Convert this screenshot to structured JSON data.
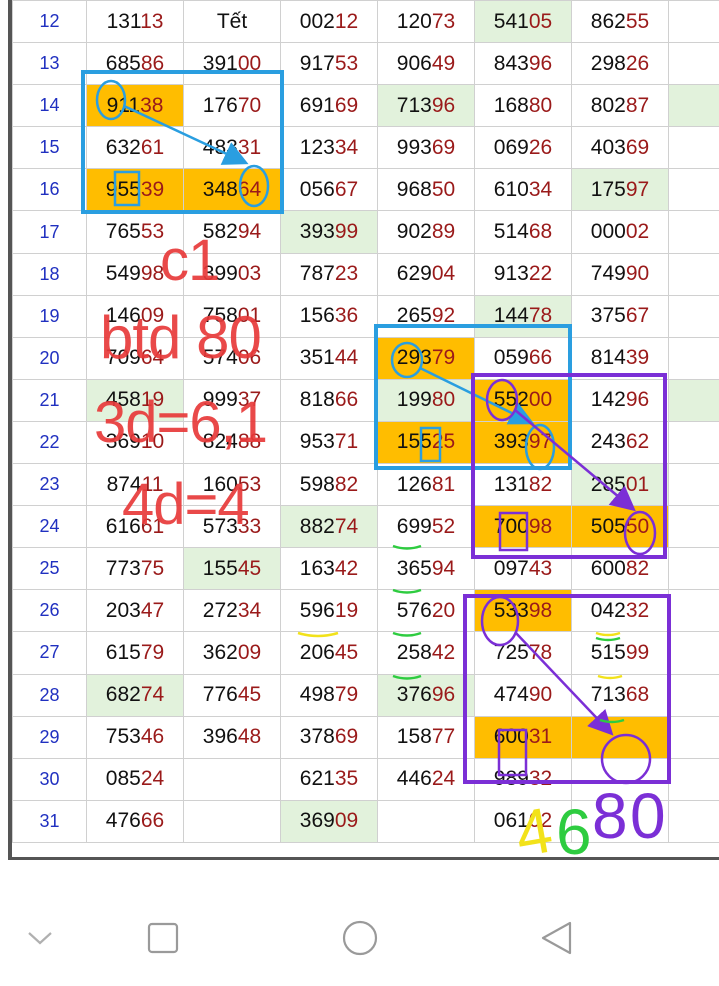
{
  "rows": [
    {
      "day": "12",
      "cells": [
        {
          "head": "131",
          "tail": "13"
        },
        {
          "text": "Tết"
        },
        {
          "head": "002",
          "tail": "12"
        },
        {
          "head": "120",
          "tail": "73"
        },
        {
          "head": "541",
          "tail": "05",
          "hl": "green"
        },
        {
          "head": "862",
          "tail": "55"
        },
        {}
      ]
    },
    {
      "day": "13",
      "cells": [
        {
          "head": "685",
          "tail": "86"
        },
        {
          "head": "391",
          "tail": "00"
        },
        {
          "head": "917",
          "tail": "53"
        },
        {
          "head": "906",
          "tail": "49"
        },
        {
          "head": "843",
          "tail": "96"
        },
        {
          "head": "298",
          "tail": "26"
        },
        {}
      ]
    },
    {
      "day": "14",
      "cells": [
        {
          "head": "911",
          "tail": "38",
          "hl": "orange"
        },
        {
          "head": "176",
          "tail": "70"
        },
        {
          "head": "691",
          "tail": "69"
        },
        {
          "head": "713",
          "tail": "96",
          "hl": "green"
        },
        {
          "head": "168",
          "tail": "80"
        },
        {
          "head": "802",
          "tail": "87"
        },
        {
          "hl": "green"
        }
      ]
    },
    {
      "day": "15",
      "cells": [
        {
          "head": "632",
          "tail": "61"
        },
        {
          "head": "483",
          "tail": "31"
        },
        {
          "head": "123",
          "tail": "34"
        },
        {
          "head": "993",
          "tail": "69"
        },
        {
          "head": "069",
          "tail": "26"
        },
        {
          "head": "403",
          "tail": "69"
        },
        {}
      ]
    },
    {
      "day": "16",
      "cells": [
        {
          "head": "955",
          "tail": "39",
          "hl": "orange"
        },
        {
          "head": "348",
          "tail": "64",
          "hl": "orange"
        },
        {
          "head": "056",
          "tail": "67"
        },
        {
          "head": "968",
          "tail": "50"
        },
        {
          "head": "610",
          "tail": "34"
        },
        {
          "head": "175",
          "tail": "97",
          "hl": "green"
        },
        {}
      ]
    },
    {
      "day": "17",
      "cells": [
        {
          "head": "765",
          "tail": "53"
        },
        {
          "head": "582",
          "tail": "94"
        },
        {
          "head": "393",
          "tail": "99",
          "hl": "green"
        },
        {
          "head": "902",
          "tail": "89"
        },
        {
          "head": "514",
          "tail": "68"
        },
        {
          "head": "000",
          "tail": "02"
        },
        {}
      ]
    },
    {
      "day": "18",
      "cells": [
        {
          "head": "549",
          "tail": "98"
        },
        {
          "head": "399",
          "tail": "03"
        },
        {
          "head": "787",
          "tail": "23"
        },
        {
          "head": "629",
          "tail": "04"
        },
        {
          "head": "913",
          "tail": "22"
        },
        {
          "head": "749",
          "tail": "90"
        },
        {}
      ]
    },
    {
      "day": "19",
      "cells": [
        {
          "head": "146",
          "tail": "09"
        },
        {
          "head": "758",
          "tail": "01"
        },
        {
          "head": "156",
          "tail": "36"
        },
        {
          "head": "265",
          "tail": "92"
        },
        {
          "head": "144",
          "tail": "78",
          "hl": "green"
        },
        {
          "head": "375",
          "tail": "67"
        },
        {}
      ]
    },
    {
      "day": "20",
      "cells": [
        {
          "head": "709",
          "tail": "64"
        },
        {
          "head": "574",
          "tail": "06"
        },
        {
          "head": "351",
          "tail": "44"
        },
        {
          "head": "293",
          "tail": "79",
          "hl": "orange"
        },
        {
          "head": "059",
          "tail": "66"
        },
        {
          "head": "814",
          "tail": "39"
        },
        {}
      ]
    },
    {
      "day": "21",
      "cells": [
        {
          "head": "458",
          "tail": "19",
          "hl": "green"
        },
        {
          "head": "999",
          "tail": "37"
        },
        {
          "head": "818",
          "tail": "66"
        },
        {
          "head": "199",
          "tail": "80",
          "hl": "green"
        },
        {
          "head": "552",
          "tail": "00",
          "hl": "orange"
        },
        {
          "head": "142",
          "tail": "96"
        },
        {
          "hl": "green"
        }
      ]
    },
    {
      "day": "22",
      "cells": [
        {
          "head": "369",
          "tail": "10"
        },
        {
          "head": "824",
          "tail": "88"
        },
        {
          "head": "953",
          "tail": "71"
        },
        {
          "head": "155",
          "tail": "25",
          "hl": "orange"
        },
        {
          "head": "393",
          "tail": "97",
          "hl": "orange"
        },
        {
          "head": "243",
          "tail": "62"
        },
        {}
      ]
    },
    {
      "day": "23",
      "cells": [
        {
          "head": "874",
          "tail": "11"
        },
        {
          "head": "160",
          "tail": "53"
        },
        {
          "head": "598",
          "tail": "82"
        },
        {
          "head": "126",
          "tail": "81"
        },
        {
          "head": "131",
          "tail": "82"
        },
        {
          "head": "285",
          "tail": "01",
          "hl": "green"
        },
        {}
      ]
    },
    {
      "day": "24",
      "cells": [
        {
          "head": "616",
          "tail": "61"
        },
        {
          "head": "573",
          "tail": "33"
        },
        {
          "head": "882",
          "tail": "74",
          "hl": "green"
        },
        {
          "head": "699",
          "tail": "52"
        },
        {
          "head": "700",
          "tail": "98",
          "hl": "orange"
        },
        {
          "head": "505",
          "tail": "50",
          "hl": "orange"
        },
        {}
      ]
    },
    {
      "day": "25",
      "cells": [
        {
          "head": "773",
          "tail": "75"
        },
        {
          "head": "155",
          "tail": "45",
          "hl": "green"
        },
        {
          "head": "163",
          "tail": "42"
        },
        {
          "head": "365",
          "tail": "94"
        },
        {
          "head": "097",
          "tail": "43"
        },
        {
          "head": "600",
          "tail": "82"
        },
        {}
      ]
    },
    {
      "day": "26",
      "cells": [
        {
          "head": "203",
          "tail": "47"
        },
        {
          "head": "272",
          "tail": "34"
        },
        {
          "head": "596",
          "tail": "19"
        },
        {
          "head": "576",
          "tail": "20"
        },
        {
          "head": "533",
          "tail": "98",
          "hl": "orange"
        },
        {
          "head": "042",
          "tail": "32"
        },
        {}
      ]
    },
    {
      "day": "27",
      "cells": [
        {
          "head": "615",
          "tail": "79"
        },
        {
          "head": "362",
          "tail": "09"
        },
        {
          "head": "206",
          "tail": "45"
        },
        {
          "head": "258",
          "tail": "42"
        },
        {
          "head": "725",
          "tail": "78"
        },
        {
          "head": "515",
          "tail": "99"
        },
        {}
      ]
    },
    {
      "day": "28",
      "cells": [
        {
          "head": "682",
          "tail": "74",
          "hl": "green"
        },
        {
          "head": "776",
          "tail": "45"
        },
        {
          "head": "498",
          "tail": "79"
        },
        {
          "head": "376",
          "tail": "96",
          "hl": "green"
        },
        {
          "head": "474",
          "tail": "90"
        },
        {
          "head": "713",
          "tail": "68"
        },
        {}
      ]
    },
    {
      "day": "29",
      "cells": [
        {
          "head": "753",
          "tail": "46"
        },
        {
          "head": "396",
          "tail": "48"
        },
        {
          "head": "378",
          "tail": "69"
        },
        {
          "head": "158",
          "tail": "77"
        },
        {
          "head": "600",
          "tail": "31",
          "hl": "orange"
        },
        {
          "hl": "orange"
        },
        {}
      ]
    },
    {
      "day": "30",
      "cells": [
        {
          "head": "085",
          "tail": "24"
        },
        {},
        {
          "head": "621",
          "tail": "35"
        },
        {
          "head": "446",
          "tail": "24"
        },
        {
          "head": "989",
          "tail": "32"
        },
        {},
        {}
      ]
    },
    {
      "day": "31",
      "cells": [
        {
          "head": "476",
          "tail": "66"
        },
        {},
        {
          "head": "369",
          "tail": "09",
          "hl": "green"
        },
        {},
        {
          "head": "061",
          "tail": "02"
        },
        {},
        {}
      ]
    }
  ],
  "annotations": {
    "line1": "c1",
    "line2": "btd 80",
    "line3": "3d=6,1",
    "line4": "4d=4",
    "footer_digits": [
      {
        "text": "4",
        "color": "#f2e21a"
      },
      {
        "text": "6",
        "color": "#2ecc40"
      },
      {
        "text": "8",
        "color": "#7b2fd6"
      },
      {
        "text": "0",
        "color": "#7b2fd6"
      }
    ]
  },
  "colors": {
    "highlight_orange": "#ffbd00",
    "highlight_green": "#e2f2dc",
    "number_tail": "#9a1a1a",
    "day_number": "#2030c0",
    "handwriting_red": "#e83a3a",
    "box_blue": "#2a9ee0",
    "box_purple": "#7b2fd6"
  },
  "navbar": {
    "back_icon": "chevron-down-icon",
    "recents_icon": "square-icon",
    "home_icon": "circle-icon",
    "back_triangle_icon": "triangle-left-icon"
  }
}
